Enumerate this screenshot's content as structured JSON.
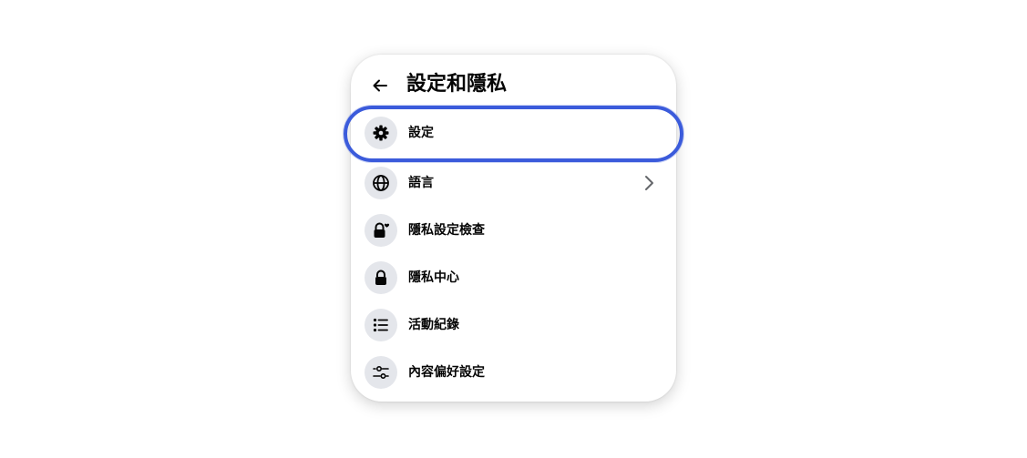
{
  "header": {
    "back_icon": "arrow-left-icon",
    "title": "設定和隱私"
  },
  "menu": {
    "items": [
      {
        "label": "設定",
        "icon": "gear-icon",
        "highlighted": true,
        "has_chevron": false
      },
      {
        "label": "語言",
        "icon": "globe-icon",
        "highlighted": false,
        "has_chevron": true
      },
      {
        "label": "隱私設定檢查",
        "icon": "lock-heart-icon",
        "highlighted": false,
        "has_chevron": false
      },
      {
        "label": "隱私中心",
        "icon": "lock-icon",
        "highlighted": false,
        "has_chevron": false
      },
      {
        "label": "活動紀錄",
        "icon": "list-icon",
        "highlighted": false,
        "has_chevron": false
      },
      {
        "label": "內容偏好設定",
        "icon": "sliders-icon",
        "highlighted": false,
        "has_chevron": false
      }
    ]
  },
  "colors": {
    "highlight_ring": "#3b5bdb",
    "icon_circle_bg": "#e4e6eb",
    "text_primary": "#050505"
  }
}
